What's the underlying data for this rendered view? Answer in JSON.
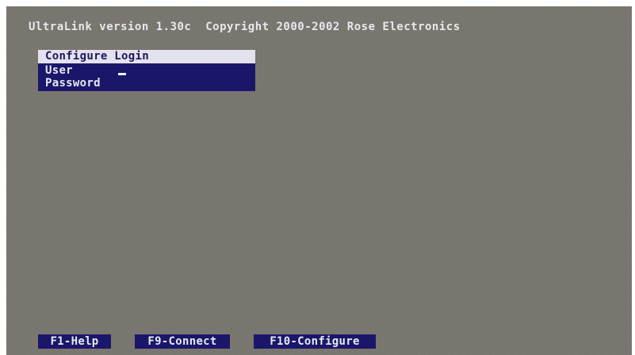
{
  "header": {
    "title": "UltraLink version 1.30c  Copyright 2000-2002 Rose Electronics"
  },
  "login": {
    "heading": "Configure Login",
    "user_label": "User",
    "password_label": "Password"
  },
  "function_keys": [
    {
      "label": "F1-Help"
    },
    {
      "label": "F9-Connect"
    },
    {
      "label": "F10-Configure"
    }
  ],
  "colors": {
    "background": "#7a7670",
    "panel": "#1a176a",
    "header_highlight": "#e4e2ee",
    "text": "#e8e8f0"
  }
}
